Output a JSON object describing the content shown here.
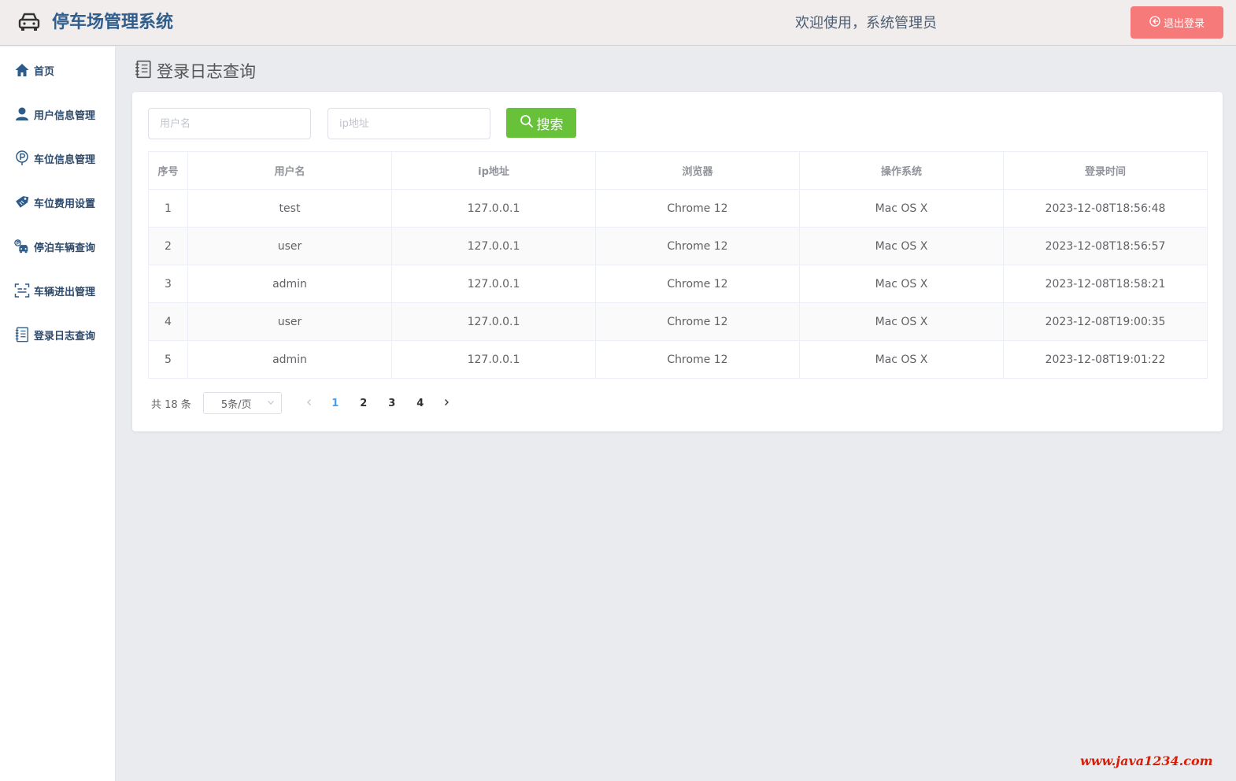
{
  "header": {
    "title": "停车场管理系统",
    "welcome": "欢迎使用，系统管理员",
    "logout_label": "退出登录",
    "logo_icon": "car-icon"
  },
  "sidebar": {
    "items": [
      {
        "label": "首页",
        "icon": "home-icon"
      },
      {
        "label": "用户信息管理",
        "icon": "user-icon"
      },
      {
        "label": "车位信息管理",
        "icon": "parking-icon"
      },
      {
        "label": "车位费用设置",
        "icon": "price-tag-icon"
      },
      {
        "label": "停泊车辆查询",
        "icon": "parked-car-icon"
      },
      {
        "label": "车辆进出管理",
        "icon": "scan-icon"
      },
      {
        "label": "登录日志查询",
        "icon": "log-book-icon"
      }
    ]
  },
  "main": {
    "page_title": "登录日志查询",
    "search": {
      "username_placeholder": "用户名",
      "ip_placeholder": "ip地址",
      "username_value": "",
      "ip_value": "",
      "button_label": "搜索"
    },
    "table": {
      "columns": [
        "序号",
        "用户名",
        "ip地址",
        "浏览器",
        "操作系统",
        "登录时间"
      ],
      "rows": [
        [
          "1",
          "test",
          "127.0.0.1",
          "Chrome 12",
          "Mac OS X",
          "2023-12-08T18:56:48"
        ],
        [
          "2",
          "user",
          "127.0.0.1",
          "Chrome 12",
          "Mac OS X",
          "2023-12-08T18:56:57"
        ],
        [
          "3",
          "admin",
          "127.0.0.1",
          "Chrome 12",
          "Mac OS X",
          "2023-12-08T18:58:21"
        ],
        [
          "4",
          "user",
          "127.0.0.1",
          "Chrome 12",
          "Mac OS X",
          "2023-12-08T19:00:35"
        ],
        [
          "5",
          "admin",
          "127.0.0.1",
          "Chrome 12",
          "Mac OS X",
          "2023-12-08T19:01:22"
        ]
      ]
    },
    "pagination": {
      "total_text": "共 18 条",
      "page_size": "5条/页",
      "pages": [
        "1",
        "2",
        "3",
        "4"
      ],
      "current_page": "1"
    }
  },
  "watermark": "www.java1234.com",
  "colors": {
    "brand_title": "#2f5d8c",
    "logout_bg": "#f67a7a",
    "search_bg": "#67c23a",
    "active_page": "#409eff",
    "watermark": "#d81e06"
  }
}
